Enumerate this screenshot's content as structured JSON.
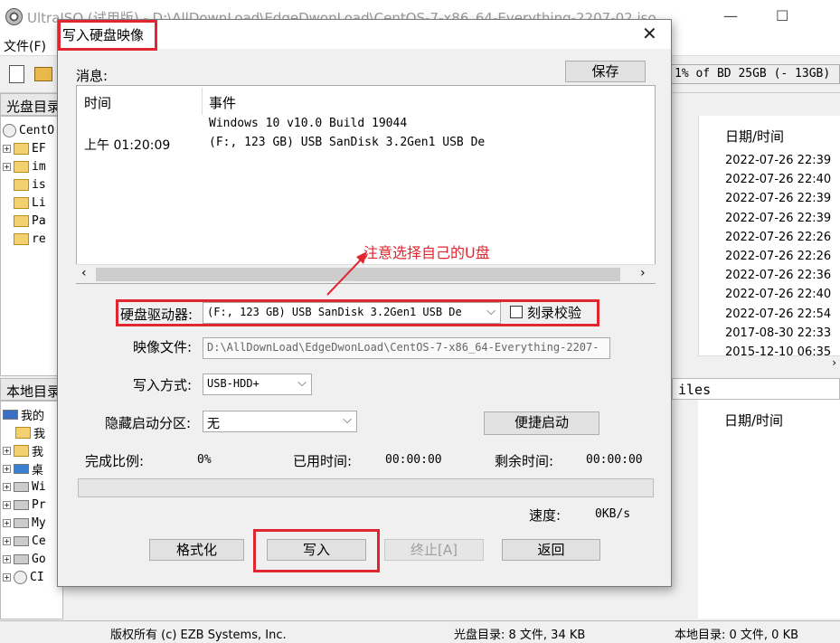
{
  "app": {
    "title": "UltraISO (试用版) - D:\\AllDownLoad\\EdgeDwonLoad\\CentOS-7-x86_64-Everything-2207-02.iso",
    "min_glyph": "—",
    "max_glyph": "☐",
    "menu_file": "文件(F)",
    "size_bar": "1% of BD 25GB (- 13GB)",
    "disc_pane_label": "光盘目录",
    "local_pane_label": "本地目录",
    "files_label": "iles",
    "disc_tree": [
      "CentO",
      "EF",
      "im",
      "is",
      "Li",
      "Pa",
      "re"
    ],
    "local_tree": [
      "我的",
      "我",
      "我",
      "桌",
      "Wi",
      "Pr",
      "My",
      "Ce",
      "Go",
      "CI"
    ],
    "date_header": "日期/时间",
    "dates": [
      "2022-07-26 22:39",
      "2022-07-26 22:40",
      "2022-07-26 22:39",
      "2022-07-26 22:39",
      "2022-07-26 22:26",
      "2022-07-26 22:26",
      "2022-07-26 22:36",
      "2022-07-26 22:40",
      "2022-07-26 22:54",
      "2017-08-30 22:33",
      "2015-12-10 06:35"
    ],
    "date_header_lower": "日期/时间",
    "status_copyright": "版权所有 (c) EZB Systems, Inc.",
    "status_disc": "光盘目录: 8 文件, 34 KB",
    "status_local": "本地目录: 0 文件, 0 KB"
  },
  "dialog": {
    "title": "写入硬盘映像",
    "close_glyph": "✕",
    "messages_label": "消息:",
    "save_button": "保存",
    "col_time": "时间",
    "col_event": "事件",
    "log": [
      {
        "time": "",
        "event": "Windows 10 v10.0 Build 19044"
      },
      {
        "time": "上午 01:20:09",
        "event": "(F:, 123 GB) USB  SanDisk 3.2Gen1 USB De"
      }
    ],
    "annotation": "注意选择自己的U盘",
    "drive_label": "硬盘驱动器:",
    "drive_value": "(F:, 123 GB) USB  SanDisk 3.2Gen1 USB De",
    "verify_label": "刻录校验",
    "image_label": "映像文件:",
    "image_value": "D:\\AllDownLoad\\EdgeDwonLoad\\CentOS-7-x86_64-Everything-2207-",
    "method_label": "写入方式:",
    "method_value": "USB-HDD+",
    "hidden_label": "隐藏启动分区:",
    "hidden_value": "无",
    "quick_boot": "便捷启动",
    "done_label": "完成比例:",
    "done_value": "0%",
    "elapsed_label": "已用时间:",
    "elapsed_value": "00:00:00",
    "remaining_label": "剩余时间:",
    "remaining_value": "00:00:00",
    "progress_fraction": 0,
    "speed_label": "速度:",
    "speed_value": "0KB/s",
    "format_button": "格式化",
    "write_button": "写入",
    "abort_button": "终止[A]",
    "back_button": "返回"
  },
  "colors": {
    "annotation_red": "#e0262e"
  }
}
